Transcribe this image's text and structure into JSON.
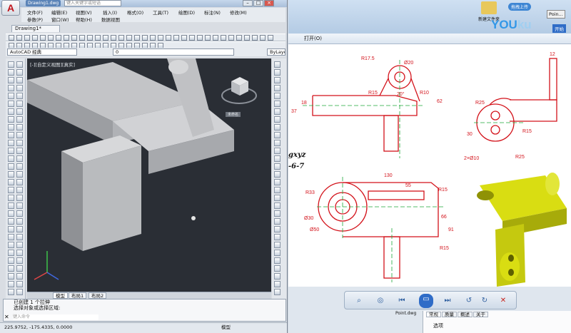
{
  "cad": {
    "drawing_tab": "Drawing1*",
    "title_tab": "Drawing1.dwg",
    "search_placeholder": "键入关键字或短语",
    "menus": [
      "文件(F)",
      "编辑(E)",
      "视图(V)",
      "插入(I)",
      "格式(O)",
      "工具(T)",
      "绘图(D)",
      "标注(N)",
      "修改(M)",
      "参数(P)",
      "窗口(W)",
      "帮助(H)",
      "数据视图"
    ],
    "workspace": "AutoCAD 经典",
    "layer_value": "0",
    "layer_combo_value": "ByLayer",
    "viewport_label": "[-][自定义视图][真实]",
    "viewcube_label": "未命名",
    "layout_tabs": [
      "模型",
      "布局1",
      "布局2"
    ],
    "command_lines": [
      "已创建 1 个拉伸",
      "选择对象或选择区域:"
    ],
    "command_placeholder": "键入命令",
    "coordinates": "225.9752, -175.4335, 0.0000",
    "status_model": "模型"
  },
  "viewer": {
    "menu_open": "打开(O)",
    "folder_label": "新建文件夹",
    "watermark_left": "YOU",
    "watermark_right": "ku",
    "pill_label": "拖拽上传",
    "top_right_tab": "Poin...",
    "top_right_btn": "开始",
    "side_text_1": "gxyz",
    "side_text_2": "-6-7",
    "dims": {
      "r175": "R17.5",
      "phi20": "Ø20",
      "r15a": "R15",
      "r10": "R10",
      "ang20": "20°",
      "d37": "37",
      "d18": "18",
      "d62": "62",
      "d12": "12",
      "r25": "R25",
      "d30": "30",
      "r15b": "R15",
      "r25b": "R25",
      "phi10": "2×Ø10",
      "d130": "130",
      "d55": "55",
      "r15c": "R15",
      "r33": "R33",
      "phi30": "Ø30",
      "phi50": "Ø50",
      "d66": "66",
      "d91": "91",
      "r15d": "R15"
    },
    "bottom_label": "Point.dwg",
    "prop_tabs": [
      "常规",
      "质量",
      "概述",
      "关于"
    ],
    "prop_row": "选项",
    "colors": {
      "drawing_red": "#d3121a",
      "solid_yellow": "#d9dd12",
      "axis_green": "#1fa83a"
    }
  }
}
